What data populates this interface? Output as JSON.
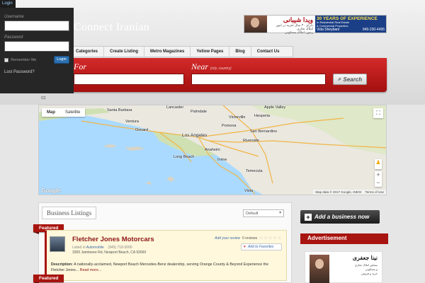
{
  "login": {
    "tab_label": "Login",
    "username_label": "Username",
    "password_label": "Password",
    "remember_label": "Remember Me",
    "login_button": "Login",
    "lost_password": "Lost Password?"
  },
  "header": {
    "brand": "Connect Iranian",
    "ad": {
      "persian_name": "ویدا شیبانی",
      "persian_sub1": "دارای ۳۰ سال تجربه در امور املاک تجاری",
      "persian_sub2": "زمین، املاک مسکونی",
      "experience": "30 YEARS OF EXPERIENCE",
      "experience_sub1": "In Residential Real Estate",
      "experience_sub2": "& Commercial Properties",
      "name": "Vida Sheybani",
      "phone": "949-230-4495"
    }
  },
  "nav": {
    "items": [
      "Categories",
      "Create Listing",
      "Metro Magazines",
      "Yellow Pages",
      "Blog",
      "Contact Us"
    ]
  },
  "search": {
    "for_label": "For",
    "near_label": "Near",
    "near_hint": "(city, country)",
    "button_label": "Search"
  },
  "map": {
    "tabs": [
      "Map",
      "Satellite"
    ],
    "cities": [
      "Santa Barbara",
      "Ventura",
      "Oxnard",
      "Los Angeles",
      "Long Beach",
      "Anaheim",
      "Riverside",
      "San Bernardino",
      "Apple Valley",
      "Hesperia",
      "Victorville",
      "Temecula",
      "Vista",
      "Irvine",
      "Pomona",
      "Palmdale",
      "Lancaster"
    ],
    "footer_data": "Map data © 2017 Google, INEGI",
    "footer_terms": "Terms of Use",
    "google_logo": "Google",
    "zoom_in": "+",
    "zoom_out": "−"
  },
  "listings": {
    "title": "Business Listings",
    "sort": "Default",
    "featured_label": "Featured",
    "items": [
      {
        "name": "Fletcher Jones Motorcars",
        "listed_in_prefix": "Listed in",
        "category": "Automobile",
        "phone": "(949) 718-3000",
        "address": "3300 Jamboree Rd, Newport Beach, CA 92660",
        "review_link": "Add your review",
        "reviews": "0 reviews",
        "favorite": "Add to Favorites",
        "description_label": "Description:",
        "description": "A nationally-acclaimed, Newport Beach Mercedes-Benz dealership, serving Orange County & Beyond Experience the Fletcher Jones...",
        "read_more": "Read more..."
      }
    ]
  },
  "sidebar": {
    "add_business": "Add a business now",
    "advertisement": "Advertisement",
    "ad_name": "نینا جعفری",
    "ad_lines": [
      "مشاور املاک تجاری",
      "و مسکونی",
      "خرید و فروش"
    ]
  }
}
